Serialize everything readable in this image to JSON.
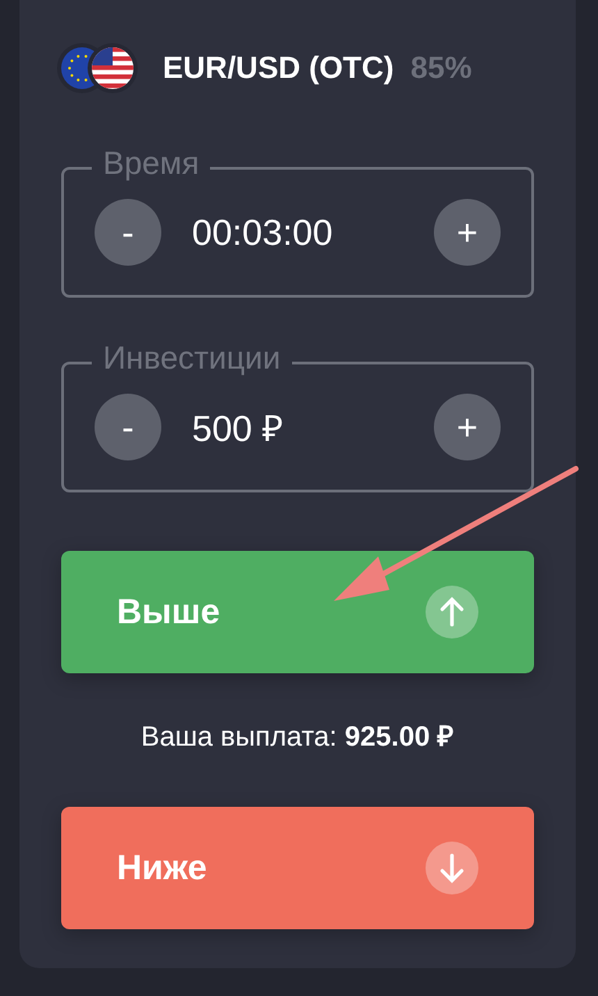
{
  "asset": {
    "pair": "EUR/USD (OTC)",
    "payout_percent": "85%"
  },
  "fields": [
    {
      "label": "Время",
      "minus": "-",
      "value": "00:03:00",
      "plus": "+"
    },
    {
      "label": "Инвестиции",
      "minus": "-",
      "value": "500 ₽",
      "plus": "+"
    }
  ],
  "buttons": [
    {
      "kind": "up",
      "label": "Выше"
    },
    {
      "kind": "down",
      "label": "Ниже"
    }
  ],
  "payout": "Ваша выплата: **925.00 ₽**"
}
